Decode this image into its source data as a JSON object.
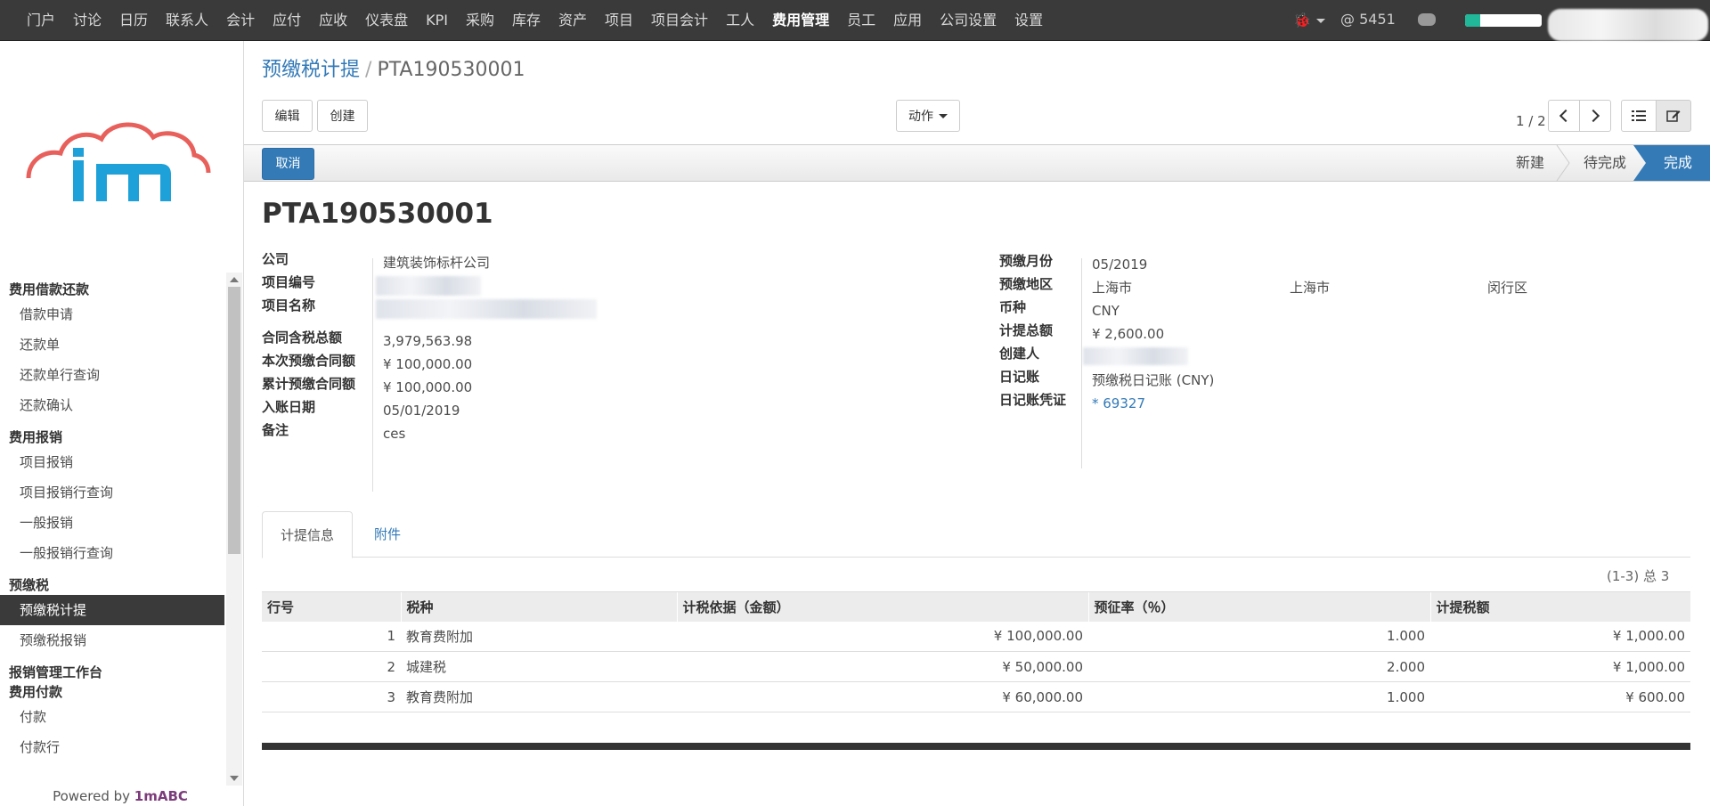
{
  "topnav": {
    "items": [
      "门户",
      "讨论",
      "日历",
      "联系人",
      "会计",
      "应付",
      "应收",
      "仪表盘",
      "KPI",
      "采购",
      "库存",
      "资产",
      "项目",
      "项目会计",
      "工人",
      "费用管理",
      "员工",
      "应用",
      "公司设置",
      "设置"
    ],
    "active_index": 15,
    "mention_count": "@ 5451",
    "progress_fraction": 0.2
  },
  "sidebar": {
    "sections": [
      {
        "title": "费用借款还款",
        "items": [
          "借款申请",
          "还款单",
          "还款单行查询",
          "还款确认"
        ]
      },
      {
        "title": "费用报销",
        "items": [
          "项目报销",
          "项目报销行查询",
          "一般报销",
          "一般报销行查询"
        ]
      },
      {
        "title": "预缴税",
        "items": [
          "预缴税计提",
          "预缴税报销"
        ]
      },
      {
        "title": "报销管理工作台",
        "items": []
      },
      {
        "title": "费用付款",
        "items": [
          "付款",
          "付款行"
        ]
      }
    ],
    "active_item": "预缴税计提",
    "powered_prefix": "Powered by ",
    "powered_brand": "1mABC"
  },
  "breadcrumb": {
    "parent": "预缴税计提",
    "separator": "/",
    "current": "PTA190530001"
  },
  "toolbar": {
    "edit": "编辑",
    "create": "创建",
    "action": "动作",
    "pager": "1 / 2"
  },
  "status": {
    "cancel": "取消",
    "stages": [
      "新建",
      "待完成",
      "完成"
    ],
    "active_stage": "完成"
  },
  "record": {
    "title": "PTA190530001",
    "left": [
      {
        "label": "公司",
        "value": "建筑装饰标杆公司"
      },
      {
        "label": "项目编号",
        "value": ""
      },
      {
        "label": "项目名称",
        "value": ""
      },
      {
        "label": "合同含税总额",
        "value": "3,979,563.98"
      },
      {
        "label": "本次预缴合同额",
        "value": "¥ 100,000.00"
      },
      {
        "label": "累计预缴合同额",
        "value": "¥ 100,000.00"
      },
      {
        "label": "入账日期",
        "value": "05/01/2019"
      },
      {
        "label": "备注",
        "value": "ces"
      }
    ],
    "right": [
      {
        "label": "预缴月份",
        "value": "05/2019"
      },
      {
        "label": "预缴地区",
        "value": "上海市",
        "value2": "上海市",
        "value3": "闵行区"
      },
      {
        "label": "币种",
        "value": "CNY"
      },
      {
        "label": "计提总额",
        "value": "¥ 2,600.00"
      },
      {
        "label": "创建人",
        "value": ""
      },
      {
        "label": "日记账",
        "value": "预缴税日记账 (CNY)"
      },
      {
        "label": "日记账凭证",
        "value": "* 69327"
      }
    ]
  },
  "tabs": [
    "计提信息",
    "附件"
  ],
  "table": {
    "count": "(1-3) 总 3",
    "headers": [
      "行号",
      "税种",
      "计税依据（金额）",
      "预征率（％）",
      "计提税额"
    ],
    "rows": [
      [
        "1",
        "教育费附加",
        "¥ 100,000.00",
        "1.000",
        "¥ 1,000.00"
      ],
      [
        "2",
        "城建税",
        "¥ 50,000.00",
        "2.000",
        "¥ 1,000.00"
      ],
      [
        "3",
        "教育费附加",
        "¥ 60,000.00",
        "1.000",
        "¥ 600.00"
      ]
    ]
  },
  "colors": {
    "navbar": "#3a3a3a",
    "primary": "#337ab7",
    "progress": "#21b799",
    "logo_cloud": "#e8605c",
    "logo_text": "#1ea0d9"
  }
}
